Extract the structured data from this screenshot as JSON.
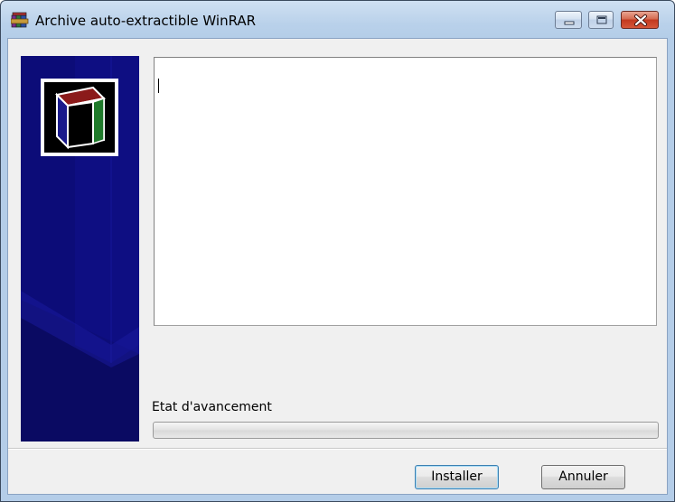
{
  "window": {
    "title": "Archive auto-extractible WinRAR",
    "controls": {
      "minimize_icon": "minimize-icon",
      "maximize_icon": "maximize-icon",
      "close_icon": "close-icon"
    },
    "app_icon": "winrar-books-icon"
  },
  "banner": {
    "logo_icon": "winrar-logo-icon",
    "background_color": "#0c0c78"
  },
  "textarea": {
    "value": ""
  },
  "progress": {
    "label": "Etat d'avancement",
    "value_percent": 0
  },
  "buttons": {
    "install_label": "Installer",
    "cancel_label": "Annuler"
  },
  "colors": {
    "close_button": "#c2391f",
    "titlebar": "#b9d1ea"
  }
}
